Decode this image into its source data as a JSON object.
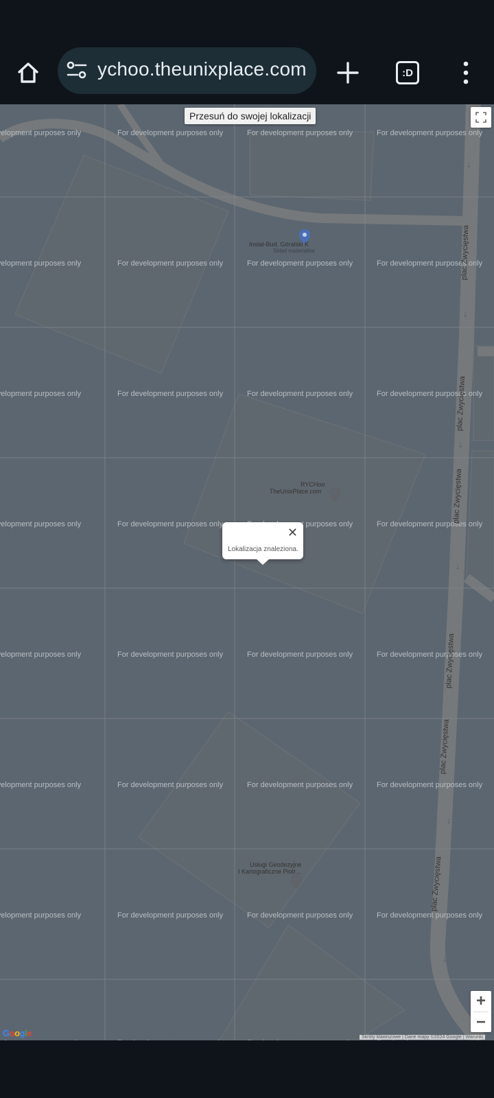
{
  "browser": {
    "url_text": "ychoo.theunixplace.com",
    "tab_switcher_label": ":D",
    "icons": [
      "home-icon",
      "site-settings-icon",
      "new-tab-icon",
      "tab-switcher-icon",
      "menu-icon"
    ]
  },
  "map": {
    "watermark": "For development purposes only",
    "pan_tooltip": "Przesuń do swojej lokalizacji",
    "popup_message": "Lokalizacja znaleziona.",
    "street_name": "plac Zwycięstwa",
    "places": [
      {
        "name": "Instal-Bud. Góralski K",
        "subtitle": "Skład materiałów"
      },
      {
        "name": "RYCHoo",
        "subtitle": "TheUnixPlace.com"
      },
      {
        "name": "Usługi Geodezyjne",
        "subtitle": "I Kartograficzne Piotr..."
      }
    ],
    "zoom_in": "+",
    "zoom_out": "−",
    "logo_text": "Google",
    "attribution": "Skróty klawiszowe | Dane mapy ©2024 Google | Warunki",
    "colors": {
      "map_background": "#5c6670",
      "road": "#76797b",
      "browser_chrome": "#0f141b",
      "omnibox": "#1d2e36"
    }
  }
}
